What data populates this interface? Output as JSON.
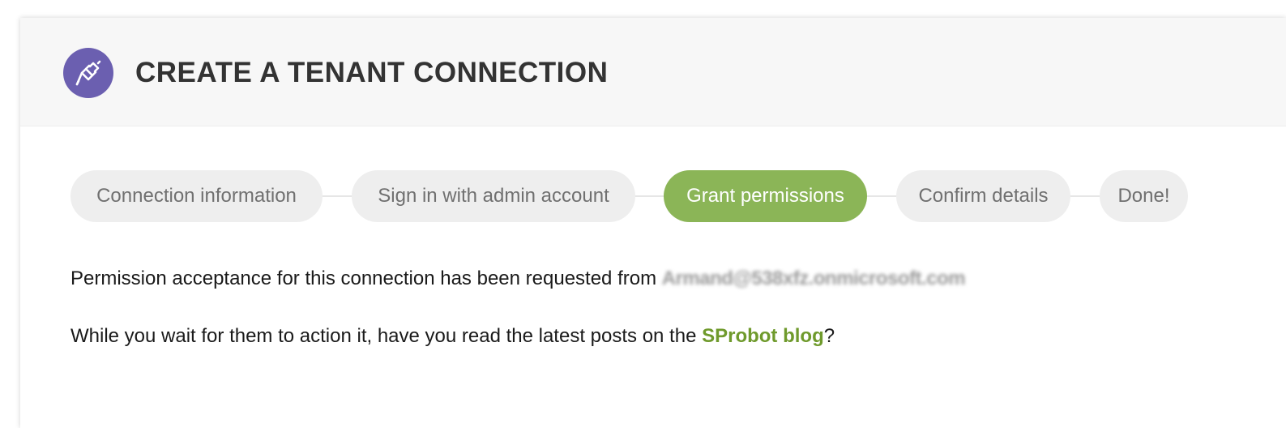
{
  "header": {
    "title": "CREATE A TENANT CONNECTION",
    "icon": "plug-connection-icon",
    "icon_bg_color": "#6b5fb0"
  },
  "wizard": {
    "active_color": "#8bb557",
    "steps": [
      {
        "label": "Connection information",
        "state": "inactive"
      },
      {
        "label": "Sign in with admin account",
        "state": "inactive"
      },
      {
        "label": "Grant permissions",
        "state": "active"
      },
      {
        "label": "Confirm details",
        "state": "inactive"
      },
      {
        "label": "Done!",
        "state": "inactive"
      }
    ]
  },
  "message": {
    "request_text": "Permission acceptance for this connection has been requested from",
    "email": "Armand@538xfz.onmicrosoft.com",
    "wait_prefix": "While you wait for them to action it, have you read the latest posts on the",
    "blog_link_label": "SProbot blog",
    "wait_suffix": "?",
    "link_color": "#6f9a2c"
  }
}
